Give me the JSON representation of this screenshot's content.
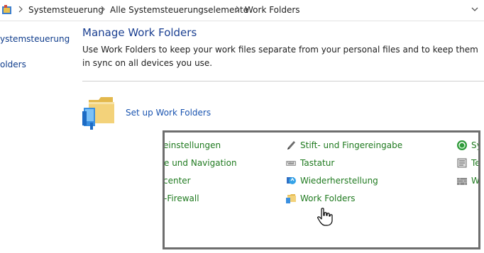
{
  "addressbar": {
    "crumbs": [
      "Systemsteuerung",
      "Alle Systemsteuerungselemente",
      "Work Folders"
    ]
  },
  "nav": {
    "items": [
      "ystemsteuerung",
      "olders"
    ]
  },
  "main": {
    "title": "Manage Work Folders",
    "description": "Use Work Folders to keep your work files separate from your personal files and to keep them in sync on all devices you use.",
    "setup_link": "Set up Work Folders"
  },
  "popup": {
    "col1": [
      "einstellungen",
      "e und Navigation",
      "center",
      "-Firewall"
    ],
    "col2": [
      "Stift- und Fingereingabe",
      "Tastatur",
      "Wiederherstellung",
      "Work Folders"
    ],
    "col3": [
      "Sy",
      "Te",
      "W"
    ],
    "link_color": "#1f7a1f"
  },
  "colors": {
    "title": "#1a3f91",
    "link": "#1a54b0"
  }
}
